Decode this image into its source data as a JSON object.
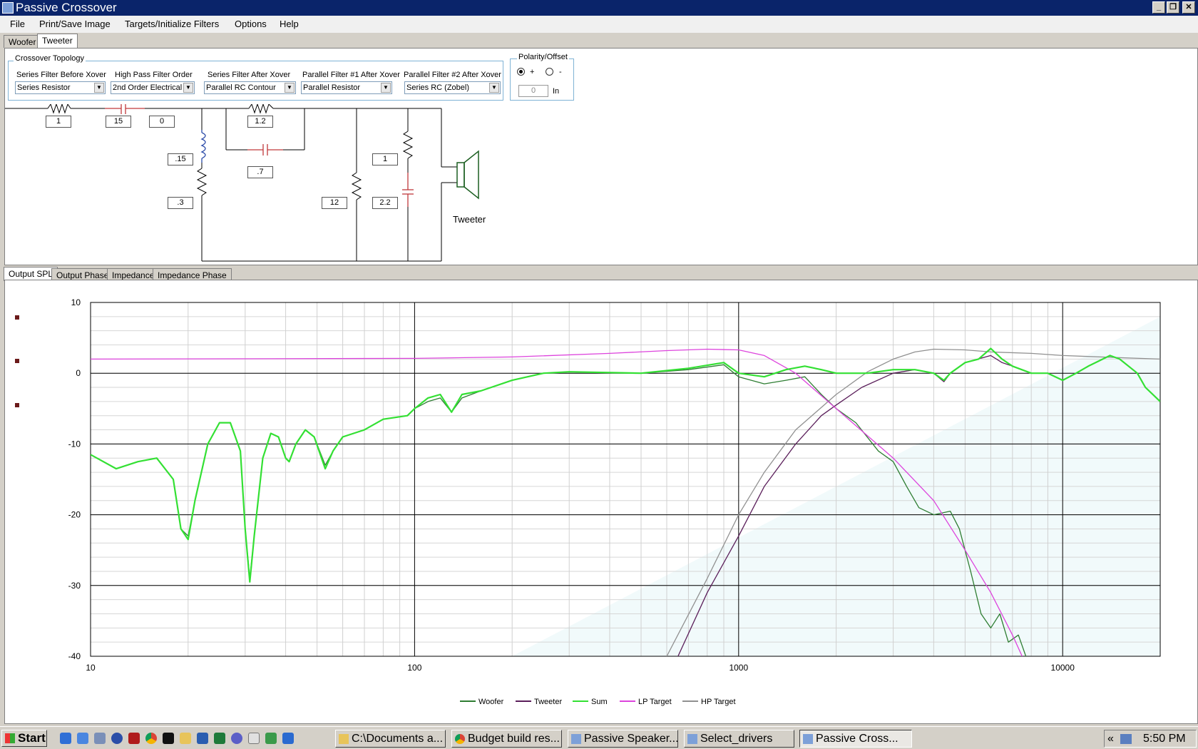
{
  "window": {
    "title": "Passive Crossover"
  },
  "menu": [
    "File",
    "Print/Save Image",
    "Targets/Initialize Filters",
    "Options",
    "Help"
  ],
  "driver_tabs": [
    "Woofer",
    "Tweeter"
  ],
  "topology": {
    "group_label": "Crossover Topology",
    "filters": [
      {
        "label": "Series Filter Before Xover",
        "value": "Series Resistor"
      },
      {
        "label": "High Pass Filter Order",
        "value": "2nd Order Electrical"
      },
      {
        "label": "Series Filter After Xover",
        "value": "Parallel RC Contour"
      },
      {
        "label": "Parallel Filter #1 After Xover",
        "value": "Parallel Resistor"
      },
      {
        "label": "Parallel Filter #2 After Xover",
        "value": "Series RC (Zobel)"
      }
    ]
  },
  "polarity": {
    "group_label": "Polarity/Offset",
    "plus_label": "+",
    "minus_label": "-",
    "offset_value": "0",
    "unit": "In",
    "selected": "+"
  },
  "circuit": {
    "values": [
      "1",
      "15",
      "0",
      ".15",
      ".3",
      "1.2",
      ".7",
      "12",
      "1",
      "2.2"
    ],
    "speaker_label": "Tweeter"
  },
  "graph_tabs": [
    "Output SPL",
    "Output Phase",
    "Impedance",
    "Impedance Phase"
  ],
  "colors": {
    "woofer": "#2e7d32",
    "tweeter": "#5a1e5a",
    "sum": "#33e033",
    "lp_target": "#dd44dd",
    "hp_target": "#909090"
  },
  "chart_data": {
    "type": "line",
    "x_scale": "log",
    "xlim": [
      10,
      20000
    ],
    "ylim": [
      -40,
      10
    ],
    "x_ticks": [
      "10",
      "100",
      "1000",
      "10000"
    ],
    "y_ticks": [
      "10",
      "0",
      "-10",
      "-20",
      "-30",
      "-40"
    ],
    "grid": true,
    "legend_position": "bottom",
    "series": [
      {
        "name": "Woofer",
        "points": [
          [
            10,
            -11.5
          ],
          [
            12,
            -13.5
          ],
          [
            14,
            -12.5
          ],
          [
            16,
            -12
          ],
          [
            18,
            -15
          ],
          [
            19,
            -22
          ],
          [
            20,
            -23
          ],
          [
            21,
            -18
          ],
          [
            23,
            -10
          ],
          [
            25,
            -7
          ],
          [
            27,
            -7
          ],
          [
            29,
            -11
          ],
          [
            30,
            -22
          ],
          [
            31,
            -29
          ],
          [
            32,
            -23
          ],
          [
            34,
            -12
          ],
          [
            36,
            -8.5
          ],
          [
            38,
            -9
          ],
          [
            40,
            -12
          ],
          [
            41,
            -12.5
          ],
          [
            43,
            -10
          ],
          [
            46,
            -8
          ],
          [
            49,
            -9
          ],
          [
            53,
            -13
          ],
          [
            56,
            -11
          ],
          [
            60,
            -9
          ],
          [
            70,
            -8
          ],
          [
            80,
            -6.5
          ],
          [
            95,
            -6
          ],
          [
            100,
            -5
          ],
          [
            110,
            -4
          ],
          [
            120,
            -3.5
          ],
          [
            130,
            -5.5
          ],
          [
            140,
            -3.5
          ],
          [
            160,
            -2.5
          ],
          [
            200,
            -1
          ],
          [
            250,
            0
          ],
          [
            300,
            0.2
          ],
          [
            500,
            0
          ],
          [
            700,
            0.5
          ],
          [
            900,
            1.2
          ],
          [
            1000,
            -0.5
          ],
          [
            1200,
            -1.5
          ],
          [
            1400,
            -1
          ],
          [
            1600,
            -0.5
          ],
          [
            1800,
            -3
          ],
          [
            2000,
            -5
          ],
          [
            2300,
            -7
          ],
          [
            2700,
            -11
          ],
          [
            3000,
            -12.5
          ],
          [
            3300,
            -16
          ],
          [
            3600,
            -19
          ],
          [
            4000,
            -20
          ],
          [
            4500,
            -19.5
          ],
          [
            4800,
            -22
          ],
          [
            5200,
            -28
          ],
          [
            5600,
            -34
          ],
          [
            6000,
            -36
          ],
          [
            6400,
            -34
          ],
          [
            6800,
            -38
          ],
          [
            7300,
            -37
          ],
          [
            7700,
            -40
          ]
        ]
      },
      {
        "name": "Tweeter",
        "points": [
          [
            650,
            -40
          ],
          [
            800,
            -31
          ],
          [
            1000,
            -23
          ],
          [
            1200,
            -16
          ],
          [
            1500,
            -10
          ],
          [
            1800,
            -6
          ],
          [
            2000,
            -4.5
          ],
          [
            2400,
            -2
          ],
          [
            3000,
            0
          ],
          [
            3500,
            0.5
          ],
          [
            4000,
            0
          ],
          [
            4300,
            -1.2
          ],
          [
            4500,
            0
          ],
          [
            5000,
            1.5
          ],
          [
            6000,
            2.5
          ],
          [
            6500,
            1.5
          ],
          [
            7000,
            1
          ],
          [
            8000,
            0
          ],
          [
            9000,
            0
          ],
          [
            10000,
            -1
          ],
          [
            11000,
            0
          ],
          [
            12000,
            1
          ],
          [
            14000,
            2.5
          ],
          [
            15000,
            2
          ],
          [
            17000,
            0
          ],
          [
            18000,
            -2
          ],
          [
            20000,
            -4
          ]
        ]
      },
      {
        "name": "Sum",
        "points": [
          [
            10,
            -11.5
          ],
          [
            12,
            -13.5
          ],
          [
            14,
            -12.5
          ],
          [
            16,
            -12
          ],
          [
            18,
            -15
          ],
          [
            19,
            -22
          ],
          [
            20,
            -23.5
          ],
          [
            21,
            -18
          ],
          [
            23,
            -10
          ],
          [
            25,
            -7
          ],
          [
            27,
            -7
          ],
          [
            29,
            -11
          ],
          [
            30,
            -22
          ],
          [
            31,
            -29.5
          ],
          [
            32,
            -23
          ],
          [
            34,
            -12
          ],
          [
            36,
            -8.5
          ],
          [
            38,
            -9
          ],
          [
            40,
            -12
          ],
          [
            41,
            -12.5
          ],
          [
            43,
            -10
          ],
          [
            46,
            -8
          ],
          [
            49,
            -9
          ],
          [
            53,
            -13.5
          ],
          [
            56,
            -11
          ],
          [
            60,
            -9
          ],
          [
            70,
            -8
          ],
          [
            80,
            -6.5
          ],
          [
            95,
            -6
          ],
          [
            100,
            -5
          ],
          [
            110,
            -3.5
          ],
          [
            120,
            -3
          ],
          [
            130,
            -5.5
          ],
          [
            140,
            -3
          ],
          [
            160,
            -2.5
          ],
          [
            200,
            -1
          ],
          [
            250,
            0
          ],
          [
            300,
            0.2
          ],
          [
            500,
            0
          ],
          [
            700,
            0.7
          ],
          [
            900,
            1.5
          ],
          [
            1000,
            0
          ],
          [
            1200,
            -0.5
          ],
          [
            1400,
            0.5
          ],
          [
            1600,
            1
          ],
          [
            1800,
            0.5
          ],
          [
            2000,
            0
          ],
          [
            2500,
            0
          ],
          [
            3000,
            0.5
          ],
          [
            3500,
            0.5
          ],
          [
            4000,
            0
          ],
          [
            4300,
            -1
          ],
          [
            4500,
            0
          ],
          [
            5000,
            1.5
          ],
          [
            5500,
            2
          ],
          [
            6000,
            3.5
          ],
          [
            6500,
            2
          ],
          [
            7000,
            1
          ],
          [
            8000,
            0
          ],
          [
            9000,
            0
          ],
          [
            10000,
            -1
          ],
          [
            11000,
            0
          ],
          [
            12000,
            1
          ],
          [
            14000,
            2.5
          ],
          [
            15000,
            2
          ],
          [
            17000,
            0
          ],
          [
            18000,
            -2
          ],
          [
            20000,
            -4
          ]
        ]
      },
      {
        "name": "LP Target",
        "points": [
          [
            10,
            2
          ],
          [
            100,
            2.1
          ],
          [
            200,
            2.3
          ],
          [
            400,
            2.8
          ],
          [
            600,
            3.2
          ],
          [
            800,
            3.4
          ],
          [
            1000,
            3.3
          ],
          [
            1200,
            2.5
          ],
          [
            1500,
            0
          ],
          [
            2000,
            -5
          ],
          [
            3000,
            -12
          ],
          [
            4000,
            -18
          ],
          [
            5000,
            -25
          ],
          [
            6000,
            -31
          ],
          [
            7000,
            -37
          ],
          [
            7500,
            -40
          ]
        ]
      },
      {
        "name": "HP Target",
        "points": [
          [
            600,
            -40
          ],
          [
            800,
            -29
          ],
          [
            1000,
            -20
          ],
          [
            1200,
            -14
          ],
          [
            1500,
            -8
          ],
          [
            2000,
            -3
          ],
          [
            2500,
            0.2
          ],
          [
            3000,
            2
          ],
          [
            3500,
            3
          ],
          [
            4000,
            3.4
          ],
          [
            5000,
            3.3
          ],
          [
            6000,
            3
          ],
          [
            8000,
            2.8
          ],
          [
            10000,
            2.5
          ],
          [
            15000,
            2.2
          ],
          [
            20000,
            2
          ]
        ]
      }
    ]
  },
  "taskbar": {
    "start": "Start",
    "buttons": [
      "C:\\Documents a...",
      "Budget build res...",
      "Passive Speaker...",
      "Select_drivers",
      "Passive Cross..."
    ],
    "active_index": 4,
    "time": "5:50 PM",
    "tray_arrow": "«"
  }
}
